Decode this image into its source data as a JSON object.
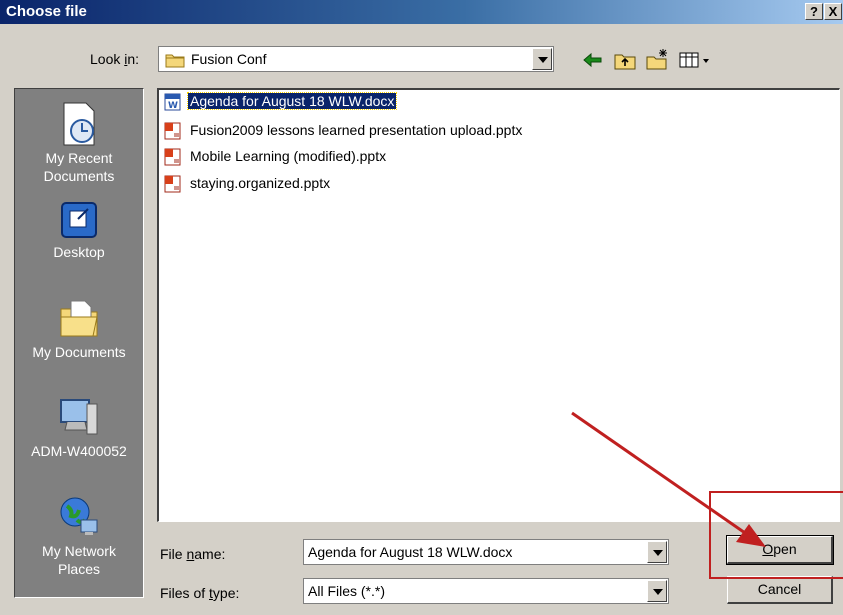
{
  "window": {
    "title": "Choose file",
    "help_label": "?",
    "close_label": "X"
  },
  "lookin": {
    "label_pre": "Look ",
    "label_accel": "i",
    "label_post": "n:",
    "value": "Fusion Conf"
  },
  "toolbar": {
    "back_icon": "back-arrow-icon",
    "up_icon": "up-folder-icon",
    "newfolder_icon": "new-folder-icon",
    "views_icon": "views-menu-icon"
  },
  "places": [
    {
      "label": "My Recent\nDocuments",
      "icon": "recent-documents-icon"
    },
    {
      "label": "Desktop",
      "icon": "desktop-icon"
    },
    {
      "label": "My Documents",
      "icon": "my-documents-icon"
    },
    {
      "label": "ADM-W400052",
      "icon": "my-computer-icon"
    },
    {
      "label": "My Network\nPlaces",
      "icon": "network-places-icon"
    }
  ],
  "files": [
    {
      "name": "Agenda for August 18 WLW.docx",
      "type": "word",
      "selected": true
    },
    {
      "name": "Fusion2009 lessons learned presentation upload.pptx",
      "type": "powerpoint",
      "selected": false
    },
    {
      "name": "Mobile Learning (modified).pptx",
      "type": "powerpoint",
      "selected": false
    },
    {
      "name": "staying.organized.pptx",
      "type": "powerpoint",
      "selected": false
    }
  ],
  "filename": {
    "label_pre": "File ",
    "label_accel": "n",
    "label_post": "ame:",
    "value": "Agenda for August 18 WLW.docx"
  },
  "filetype": {
    "label_pre": "Files of ",
    "label_accel": "t",
    "label_post": "ype:",
    "value": "All Files (*.*)"
  },
  "buttons": {
    "open_accel": "O",
    "open_rest": "pen",
    "cancel_label": "Cancel"
  },
  "colors": {
    "title_bar": "#0a246a",
    "selection": "#0a246a",
    "annotation": "#c02020",
    "places_bg": "#808080"
  }
}
